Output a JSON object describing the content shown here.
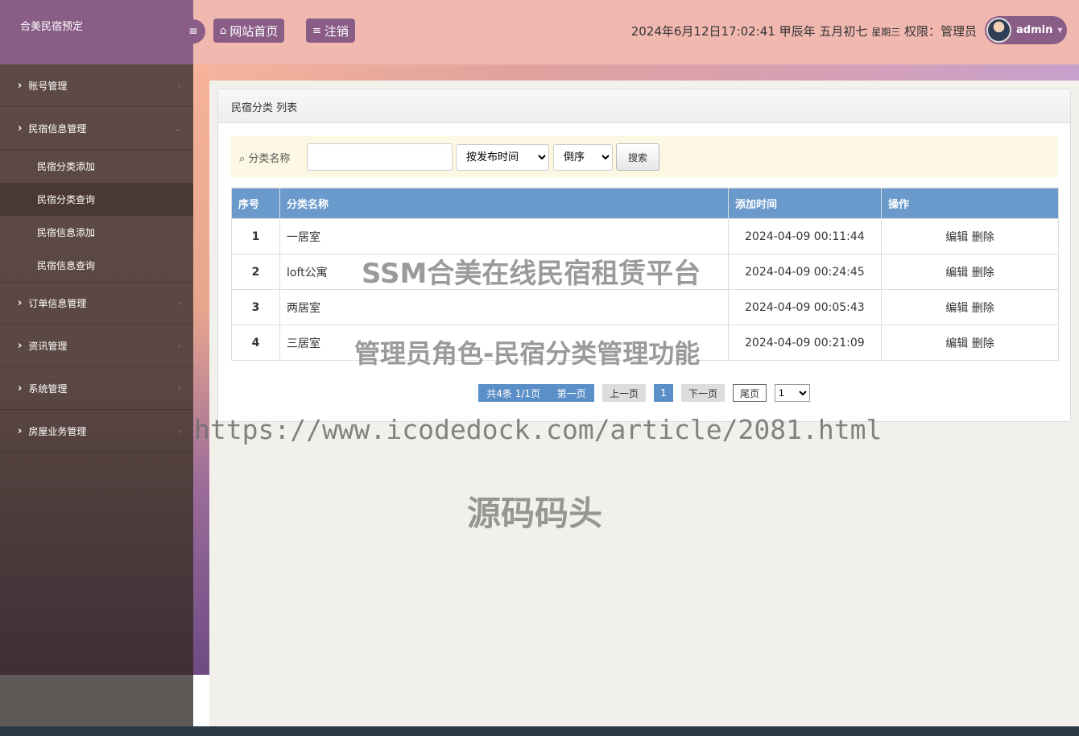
{
  "sidebar": {
    "brand": "合美民宿预定",
    "items": [
      {
        "label": "账号管理"
      },
      {
        "label": "民宿信息管理"
      },
      {
        "label": "订单信息管理"
      },
      {
        "label": "资讯管理"
      },
      {
        "label": "系统管理"
      },
      {
        "label": "房屋业务管理"
      }
    ],
    "sub_items": [
      {
        "label": "民宿分类添加"
      },
      {
        "label": "民宿分类查询"
      },
      {
        "label": "民宿信息添加"
      },
      {
        "label": "民宿信息查询"
      }
    ]
  },
  "header": {
    "home_label": "网站首页",
    "logout_label": "注销",
    "datetime": "2024年6月12日17:02:41 甲辰年 五月初七",
    "weekday": "星期三",
    "role": "权限：管理员",
    "username": "admin"
  },
  "panel": {
    "title": "民宿分类 列表"
  },
  "search": {
    "label": "分类名称",
    "sort_field": "按发布时间",
    "sort_order": "倒序",
    "button": "搜索"
  },
  "table": {
    "headers": [
      "序号",
      "分类名称",
      "添加时间",
      "操作"
    ],
    "rows": [
      {
        "no": "1",
        "name": "一居室",
        "time": "2024-04-09 00:11:44"
      },
      {
        "no": "2",
        "name": "loft公寓",
        "time": "2024-04-09 00:24:45"
      },
      {
        "no": "3",
        "name": "两居室",
        "time": "2024-04-09 00:05:43"
      },
      {
        "no": "4",
        "name": "三居室",
        "time": "2024-04-09 00:21:09"
      }
    ],
    "edit_label": "编辑",
    "delete_label": "删除"
  },
  "pagination": {
    "summary": "共4条  1/1页",
    "first": "第一页",
    "prev": "上一页",
    "current": "1",
    "next": "下一页",
    "last": "尾页",
    "page_select": "1"
  },
  "watermarks": {
    "title": "SSM合美在线民宿租赁平台",
    "subtitle": "管理员角色-民宿分类管理功能",
    "url": "https://www.icodedock.com/article/2081.html",
    "brand": "源码码头"
  },
  "colors": {
    "primary": "#8a5d87",
    "table_header": "#6a99cb",
    "header_bg": "#f1b8b0"
  }
}
